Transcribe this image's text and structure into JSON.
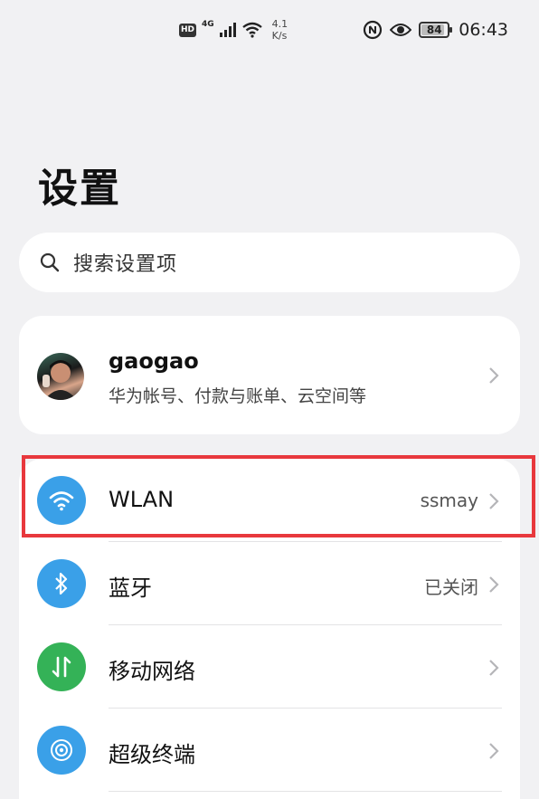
{
  "status_bar": {
    "hd": "HD",
    "network": "4G",
    "speed_value": "4.1",
    "speed_unit": "K/s",
    "battery": "84",
    "time": "06:43"
  },
  "page": {
    "title": "设置"
  },
  "search": {
    "placeholder": "搜索设置项"
  },
  "account": {
    "name": "gaogao",
    "subtitle": "华为帐号、付款与账单、云空间等"
  },
  "settings": [
    {
      "label": "WLAN",
      "value": "ssmay",
      "icon": "wifi-icon",
      "color": "#3aa0e8"
    },
    {
      "label": "蓝牙",
      "value": "已关闭",
      "icon": "bluetooth-icon",
      "color": "#3aa0e8"
    },
    {
      "label": "移动网络",
      "value": "",
      "icon": "mobile-network-icon",
      "color": "#34b257"
    },
    {
      "label": "超级终端",
      "value": "",
      "icon": "super-device-icon",
      "color": "#3aa0e8"
    }
  ],
  "colors": {
    "background": "#f1f1f3",
    "highlight": "#e8383d",
    "blue": "#3aa0e8",
    "green": "#34b257"
  }
}
